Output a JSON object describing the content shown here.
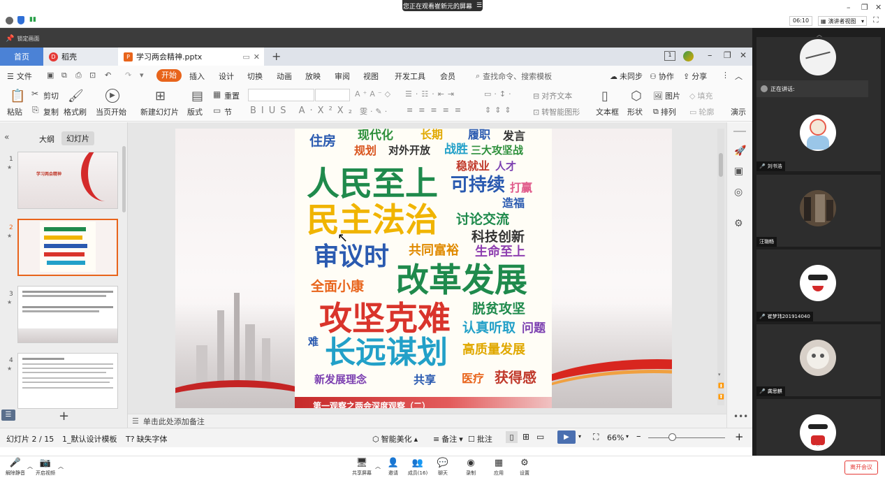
{
  "meeting": {
    "banner": "您正在观看崔新元的屏幕",
    "timer": "06:10",
    "view_mode": "演讲者视图"
  },
  "lock_label": "锁定画面",
  "tabs": [
    {
      "label": "首页"
    },
    {
      "label": "稻壳"
    },
    {
      "label": "学习两会精神.pptx"
    }
  ],
  "menu": {
    "file": "文件",
    "start": "开始",
    "items": [
      "插入",
      "设计",
      "切换",
      "动画",
      "放映",
      "审阅",
      "视图",
      "开发工具",
      "会员"
    ],
    "search_placeholder": "查找命令、搜索模板",
    "unsynced": "未同步",
    "collab": "协作",
    "share": "分享"
  },
  "ribbon": {
    "cut": "剪切",
    "copy": "复制",
    "paste": "粘贴",
    "format_brush": "格式刷",
    "from_start": "当页开始",
    "new_slide": "新建幻灯片",
    "layout": "版式",
    "reset": "重置",
    "section": "节",
    "align_text": "对齐文本",
    "smart_shape": "转智能图形",
    "textbox": "文本框",
    "shape": "形状",
    "image": "图片",
    "arrange": "排列",
    "fill": "填充",
    "outline": "轮廓",
    "show": "演示"
  },
  "panel": {
    "outline_tab": "大纲",
    "slides_tab": "幻灯片",
    "thumbs": [
      {
        "num": "1",
        "title": "学习两会精神"
      },
      {
        "num": "2"
      },
      {
        "num": "3"
      },
      {
        "num": "4"
      }
    ]
  },
  "slide": {
    "words": [
      {
        "t": "住房",
        "c": "#2a5ab0"
      },
      {
        "t": "现代化",
        "c": "#2c8f3a"
      },
      {
        "t": "长期",
        "c": "#e0a800"
      },
      {
        "t": "履职",
        "c": "#2a5ab0"
      },
      {
        "t": "发言",
        "c": "#333333"
      },
      {
        "t": "规划",
        "c": "#d9541e"
      },
      {
        "t": "对外开放",
        "c": "#333333"
      },
      {
        "t": "战胜",
        "c": "#22a0c8"
      },
      {
        "t": "三大攻坚战",
        "c": "#2c8f3a"
      },
      {
        "t": "稳就业",
        "c": "#c0392b"
      },
      {
        "t": "人才",
        "c": "#7b3fb0"
      },
      {
        "t": "人民至上",
        "c": "#1f8a4c"
      },
      {
        "t": "可持续",
        "c": "#2a5ab0"
      },
      {
        "t": "打赢",
        "c": "#e05a8a"
      },
      {
        "t": "造福",
        "c": "#2a5ab0"
      },
      {
        "t": "民主法治",
        "c": "#f0b400"
      },
      {
        "t": "讨论交流",
        "c": "#1f8a4c"
      },
      {
        "t": "科技创新",
        "c": "#333333"
      },
      {
        "t": "审议时",
        "c": "#2a5ab0"
      },
      {
        "t": "共同富裕",
        "c": "#e08a00"
      },
      {
        "t": "生命至上",
        "c": "#8e3fb0"
      },
      {
        "t": "全面小康",
        "c": "#e8641b"
      },
      {
        "t": "改革发展",
        "c": "#1f8a4c"
      },
      {
        "t": "脱贫攻坚",
        "c": "#1f8a4c"
      },
      {
        "t": "攻坚克难",
        "c": "#d9342b"
      },
      {
        "t": "认真听取",
        "c": "#22a0c8"
      },
      {
        "t": "问题",
        "c": "#7b3fb0"
      },
      {
        "t": "难",
        "c": "#2a5ab0"
      },
      {
        "t": "长远谋划",
        "c": "#22a0c8"
      },
      {
        "t": "高质量发展",
        "c": "#e0a800"
      },
      {
        "t": "新发展理念",
        "c": "#7b3fb0"
      },
      {
        "t": "共享",
        "c": "#2a5ab0"
      },
      {
        "t": "医疗",
        "c": "#e8641b"
      },
      {
        "t": "获得感",
        "c": "#c0392b"
      }
    ],
    "banner_text": "第一观察之两会深度观察（二）"
  },
  "notes_placeholder": "单击此处添加备注",
  "status": {
    "slide_count": "幻灯片 2 / 15",
    "template": "1_默认设计模板",
    "missing_font": "缺失字体",
    "beautify": "智能美化",
    "notes": "备注",
    "comments": "批注",
    "zoom": "66%"
  },
  "participants": [
    {
      "name": "正在讲话:"
    },
    {
      "name": "刘书浩"
    },
    {
      "name": "汪璐畅"
    },
    {
      "name": "崔梦玮201914040"
    },
    {
      "name": "龚思麒"
    }
  ],
  "bottom": {
    "mute": "解除静音",
    "video": "开启视频",
    "share": "共享屏幕",
    "invite": "邀请",
    "members": "成员(16)",
    "chat": "聊天",
    "record": "录制",
    "apps": "应用",
    "settings": "设置",
    "leave": "离开会议"
  },
  "colors": {
    "accent": "#e8641b",
    "home_tab": "#4b82d6",
    "leave": "#e53935"
  }
}
